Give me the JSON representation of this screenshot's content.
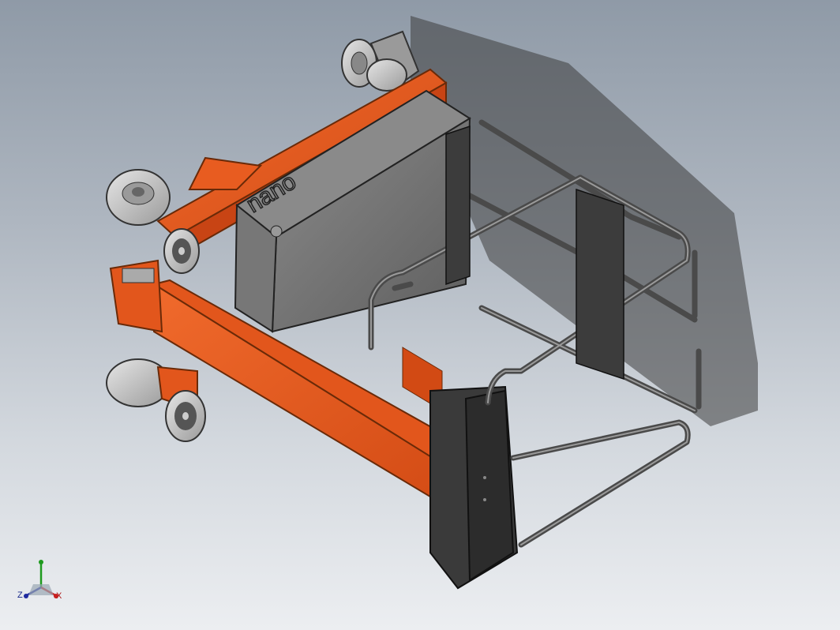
{
  "viewport": {
    "background_top": "#8f9aa7",
    "background_bottom": "#eceef1"
  },
  "model": {
    "frame_color": "#e2561c",
    "frame_dark": "#b9400f",
    "panel_color": "#6e6e6e",
    "tube_color": "#5b5b5b",
    "wheel_color": "#bfbfbf",
    "box_text": "nano"
  },
  "triad": {
    "x_label": "X",
    "y_label": "",
    "z_label": "Z",
    "x_color": "#c81e1e",
    "y_color": "#1e9a1e",
    "z_color": "#1e2aa0"
  }
}
